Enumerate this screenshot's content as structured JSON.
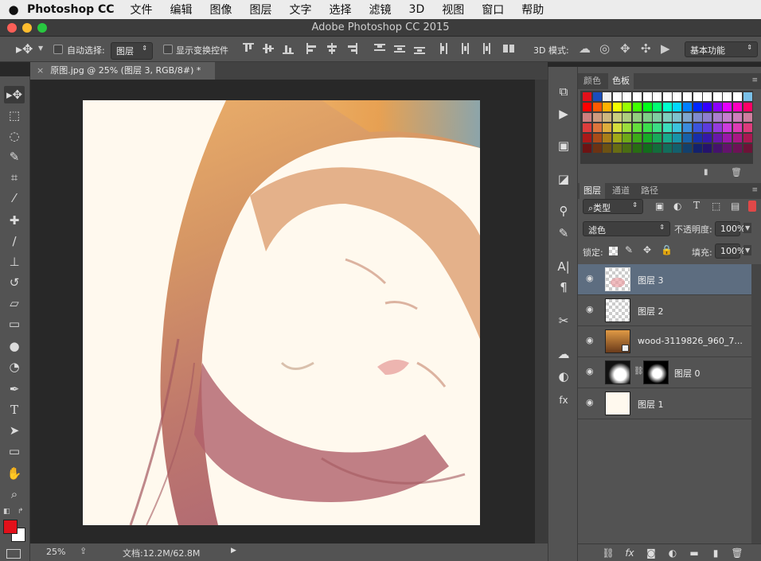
{
  "menubar": {
    "app": "Photoshop CC",
    "items": [
      "文件",
      "编辑",
      "图像",
      "图层",
      "文字",
      "选择",
      "滤镜",
      "3D",
      "视图",
      "窗口",
      "帮助"
    ]
  },
  "window": {
    "title": "Adobe Photoshop CC 2015"
  },
  "options": {
    "auto_select": "自动选择:",
    "auto_select_target": "图层",
    "show_transform": "显示变换控件",
    "mode_3d": "3D 模式:",
    "workspace": "基本功能"
  },
  "document": {
    "tab": "原图.jpg @ 25% (图层 3, RGB/8#) *"
  },
  "status": {
    "zoom": "25%",
    "doc": "文档:12.2M/62.8M"
  },
  "panels": {
    "color_tabs": [
      "颜色",
      "色板"
    ],
    "layer_tabs": [
      "图层",
      "通道",
      "路径"
    ]
  },
  "layers_panel": {
    "filter": "类型",
    "blend_mode": "滤色",
    "opacity_label": "不透明度:",
    "opacity": "100%",
    "lock_label": "锁定:",
    "fill_label": "填充:",
    "fill": "100%",
    "layers": [
      {
        "name": "图层 3"
      },
      {
        "name": "图层 2"
      },
      {
        "name": "wood-3119826_960_7..."
      },
      {
        "name": "图层 0"
      },
      {
        "name": "图层 1"
      }
    ]
  },
  "colors": {
    "foreground": "#e3101a",
    "background": "#ffffff",
    "selected_layer": "#5d6d80"
  }
}
